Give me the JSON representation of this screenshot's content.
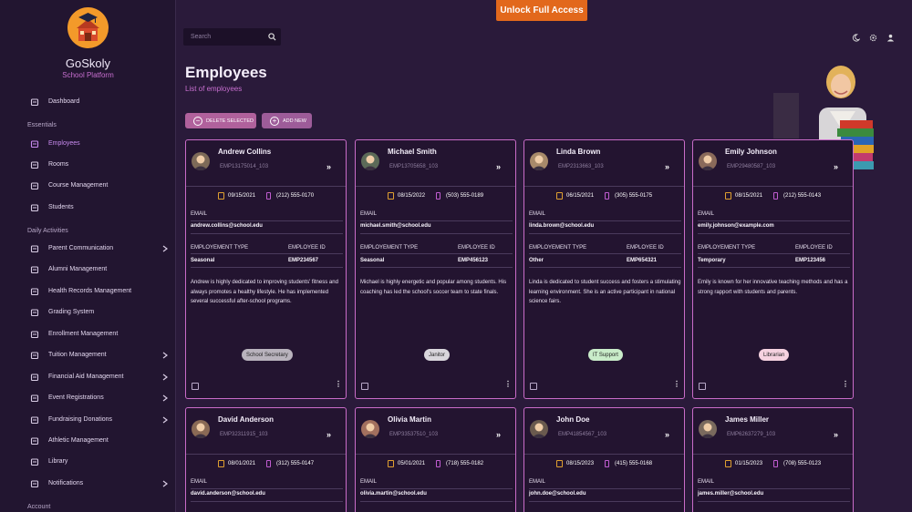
{
  "app": {
    "name": "GoSkoly",
    "subtitle": "School Platform"
  },
  "topbar": {
    "unlock_label": "Unlock Full Access",
    "search_placeholder": "Search"
  },
  "sidebar": {
    "items": [
      {
        "label": "Dashboard",
        "icon": "home-icon"
      },
      {
        "label": "Employees",
        "icon": "employees-icon",
        "active": true
      },
      {
        "label": "Rooms",
        "icon": "rooms-icon"
      },
      {
        "label": "Course Management",
        "icon": "course-icon"
      },
      {
        "label": "Students",
        "icon": "students-icon"
      },
      {
        "label": "Parent Communication",
        "icon": "chat-icon",
        "submenu": true
      },
      {
        "label": "Alumni Management",
        "icon": "alumni-icon"
      },
      {
        "label": "Health Records Management",
        "icon": "health-icon"
      },
      {
        "label": "Grading System",
        "icon": "star-icon"
      },
      {
        "label": "Enrollment Management",
        "icon": "enrollment-icon"
      },
      {
        "label": "Tuition Management",
        "icon": "dollar-icon",
        "submenu": true
      },
      {
        "label": "Financial Aid Management",
        "icon": "financial-aid-icon",
        "submenu": true
      },
      {
        "label": "Event Registrations",
        "icon": "event-icon",
        "submenu": true
      },
      {
        "label": "Fundraising Donations",
        "icon": "donation-icon",
        "submenu": true
      },
      {
        "label": "Athletic Management",
        "icon": "athletic-icon"
      },
      {
        "label": "Library",
        "icon": "library-icon"
      },
      {
        "label": "Notifications",
        "icon": "bell-icon",
        "submenu": true
      }
    ],
    "sections": {
      "essentials": "Essentials",
      "daily": "Daily Activities",
      "account": "Account"
    }
  },
  "page": {
    "title": "Employees",
    "subtitle": "List of employees",
    "delete_label": "DELETE SELECTED",
    "add_label": "ADD NEW"
  },
  "card_labels": {
    "email": "EMAIL",
    "type": "EMPLOYEMENT TYPE",
    "id": "EMPLOYEE ID"
  },
  "employees": [
    {
      "name": "Andrew Collins",
      "code": "EMP13175014_103",
      "date": "09/15/2021",
      "phone": "(212) 555-0170",
      "email": "andrew.collins@school.edu",
      "type": "Seasonal",
      "emp_id": "EMP234567",
      "bio": "Andrew is highly dedicated to improving students' fitness and always promotes a healthy lifestyle. He has implemented several successful after-school programs.",
      "tag": "School Secretary",
      "tag_color": "#b9b3bd"
    },
    {
      "name": "Michael Smith",
      "code": "EMP13705658_103",
      "date": "08/15/2022",
      "phone": "(503) 555-0189",
      "email": "michael.smith@school.edu",
      "type": "Seasonal",
      "emp_id": "EMP456123",
      "bio": "Michael is highly energetic and popular among students. His coaching has led the school's soccer team to state finals.",
      "tag": "Janitor",
      "tag_color": "#d9d6dc"
    },
    {
      "name": "Linda Brown",
      "code": "EMP2313663_103",
      "date": "06/15/2021",
      "phone": "(305) 555-0175",
      "email": "linda.brown@school.edu",
      "type": "Other",
      "emp_id": "EMP654321",
      "bio": "Linda is dedicated to student success and fosters a stimulating learning environment. She is an active participant in national science fairs.",
      "tag": "IT Support",
      "tag_color": "#c9ecc9"
    },
    {
      "name": "Emily Johnson",
      "code": "EMP29480587_103",
      "date": "08/15/2021",
      "phone": "(212) 555-0143",
      "email": "emily.johnson@example.com",
      "type": "Temporary",
      "emp_id": "EMP123456",
      "bio": "Emily is known for her innovative teaching methods and has a strong rapport with students and parents.",
      "tag": "Librarian",
      "tag_color": "#f6d2e0"
    },
    {
      "name": "David Anderson",
      "code": "EMP32311915_103",
      "date": "08/01/2021",
      "phone": "(312) 555-0147",
      "email": "david.anderson@school.edu"
    },
    {
      "name": "Olivia Martin",
      "code": "EMP33537510_103",
      "date": "05/01/2021",
      "phone": "(718) 555-0182",
      "email": "olivia.martin@school.edu"
    },
    {
      "name": "John Doe",
      "code": "EMP41854567_103",
      "date": "08/15/2023",
      "phone": "(415) 555-0168",
      "email": "john.doe@school.edu"
    },
    {
      "name": "James Miller",
      "code": "EMP62637279_103",
      "date": "01/15/2023",
      "phone": "(708) 555-0123",
      "email": "james.miller@school.edu"
    }
  ]
}
